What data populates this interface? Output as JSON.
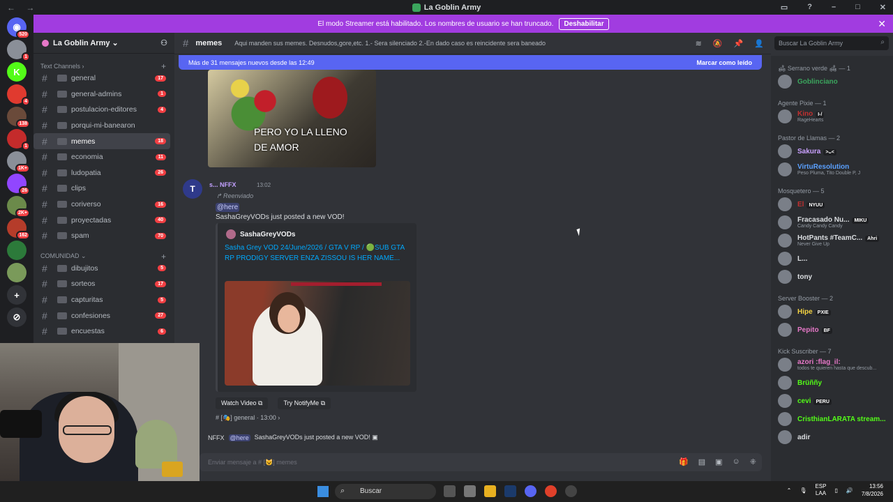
{
  "window": {
    "title": "La Goblin Army",
    "nav": "← →"
  },
  "streamer_banner": {
    "text": "El modo Streamer está habilitado. Los nombres de usuario se han truncado.",
    "button": "Deshabilitar",
    "close": "✕"
  },
  "servers": [
    {
      "color": "#5865f2",
      "badge": "520",
      "glyph": "◉"
    },
    {
      "color": "#8a8f98",
      "badge": "1",
      "glyph": ""
    },
    {
      "color": "#53fc18",
      "badge": "",
      "glyph": "K"
    },
    {
      "color": "#e03a2f",
      "badge": "4",
      "glyph": ""
    },
    {
      "color": "#6a4a3a",
      "badge": "138",
      "glyph": ""
    },
    {
      "color": "#c42b2b",
      "badge": "1",
      "glyph": ""
    },
    {
      "color": "#8a8f98",
      "badge": "1K+",
      "glyph": ""
    },
    {
      "color": "#9146ff",
      "badge": "26",
      "glyph": ""
    },
    {
      "color": "#6b8a4a",
      "badge": "2K+",
      "glyph": ""
    },
    {
      "color": "#b53c2a",
      "badge": "162",
      "glyph": ""
    },
    {
      "color": "#2c7a3a",
      "badge": "",
      "glyph": ""
    },
    {
      "color": "#7a9a5a",
      "badge": "",
      "glyph": ""
    },
    {
      "color": "#313338",
      "badge": "",
      "glyph": "+"
    },
    {
      "color": "#313338",
      "badge": "",
      "glyph": "⊘"
    }
  ],
  "guild": {
    "name": "La Goblin Army ⌄"
  },
  "categories": {
    "text": "Text Channels ›",
    "comunidad": "COMUNIDAD ⌄"
  },
  "channels": [
    {
      "name": "general",
      "count": "17"
    },
    {
      "name": "general-admins",
      "count": "1"
    },
    {
      "name": "postulacion-editores",
      "count": "4"
    },
    {
      "name": "porqui-mi-banearon",
      "count": ""
    },
    {
      "name": "memes",
      "count": "18"
    },
    {
      "name": "economia",
      "count": "11"
    },
    {
      "name": "ludopatia",
      "count": "26"
    },
    {
      "name": "clips",
      "count": ""
    },
    {
      "name": "coriverso",
      "count": "16"
    },
    {
      "name": "proyectadas",
      "count": "40"
    },
    {
      "name": "spam",
      "count": "70"
    }
  ],
  "channels2": [
    {
      "name": "dibujitos",
      "count": "5"
    },
    {
      "name": "sorteos",
      "count": "17"
    },
    {
      "name": "capturitas",
      "count": "5"
    },
    {
      "name": "confesiones",
      "count": "27"
    },
    {
      "name": "encuestas",
      "count": "6"
    }
  ],
  "channel_header": {
    "name": "memes",
    "topic": "Aqui manden sus memes. Desnudos,gore,etc. 1.- Sera silenciado 2.-En dado caso es reincidente sera baneado"
  },
  "search": {
    "placeholder": "Buscar La Goblin Army"
  },
  "new_messages": {
    "text": "Más de 31 mensajes nuevos desde las 12:49",
    "mark": "Marcar como leído"
  },
  "meme": {
    "caption": "PERO YO LA LLENO\nDE AMOR"
  },
  "message": {
    "username": "s... NFFX",
    "time": "13:02",
    "forwarded": "↱ Reenviado",
    "mention": "@here",
    "text": "SashaGreyVODs just posted a new VOD!",
    "embed_author": "SashaGreyVODs",
    "embed_title": "Sasha Grey VOD 24/June/2026 / GTA V RP / 🟢SUB GTA RP PRODIGY SERVER ENZA ZISSOU IS HER NAME...",
    "btn_watch": "Watch Video ⧉",
    "btn_notify": "Try NotifyMe ⧉",
    "channel_ref": "# [🎭] general · 13:00 ›"
  },
  "next_message": {
    "user": "NFFX",
    "mention": "@here",
    "text": "SashaGreyVODs just posted a new VOD! ▣"
  },
  "composer": {
    "placeholder": "Enviar mensaje a # [😺] memes"
  },
  "member_groups": [
    {
      "title": "🛋 Serrano verde 🛋 — 1",
      "members": [
        {
          "name": "Goblinciano",
          "color": "#3ba55d",
          "sub": "",
          "tag": ""
        }
      ]
    },
    {
      "title": "Agente Pixie — 1",
      "members": [
        {
          "name": "Kino",
          "color": "#c03030",
          "sub": "RageHearts",
          "tag": "I-/"
        }
      ]
    },
    {
      "title": "Pastor de Llamas — 2",
      "members": [
        {
          "name": "Sakura",
          "color": "#c9a0ff",
          "sub": "",
          "tag": ">ᴗ<"
        },
        {
          "name": "VirtuResolution",
          "color": "#5aa0ff",
          "sub": "Peso Pluma, Tito Double P, J",
          "tag": ""
        }
      ]
    },
    {
      "title": "Mosquetero — 5",
      "members": [
        {
          "name": "El",
          "color": "#c03030",
          "sub": "",
          "tag": "NYUU"
        },
        {
          "name": "Fracasado Nu...",
          "color": "#dbdee1",
          "sub": "Candy Candy Candy",
          "tag": "MIKU"
        },
        {
          "name": "HotPants #TeamC...",
          "color": "#dbdee1",
          "sub": "Never Give Up",
          "tag": "Ahri"
        },
        {
          "name": "L...",
          "color": "#dbdee1",
          "sub": "",
          "tag": ""
        },
        {
          "name": "tony",
          "color": "#dbdee1",
          "sub": "",
          "tag": ""
        }
      ]
    },
    {
      "title": "Server Booster — 2",
      "members": [
        {
          "name": "Hipe",
          "color": "#f5d442",
          "sub": "",
          "tag": "PXIE"
        },
        {
          "name": "Pepito",
          "color": "#e678c8",
          "sub": "",
          "tag": "BF"
        }
      ]
    },
    {
      "title": "Kick Suscriber — 7",
      "members": [
        {
          "name": "azori :flag_il:",
          "color": "#e678c8",
          "sub": "todos te quieren hasta que descub...",
          "tag": ""
        },
        {
          "name": "Brüññy",
          "color": "#53fc18",
          "sub": "",
          "tag": ""
        },
        {
          "name": "cevi",
          "color": "#53fc18",
          "sub": "",
          "tag": "PERU"
        },
        {
          "name": "CristhianLARATA stream...",
          "color": "#53fc18",
          "sub": "",
          "tag": ""
        },
        {
          "name": "adir",
          "color": "#dbdee1",
          "sub": "",
          "tag": ""
        }
      ]
    }
  ],
  "taskbar": {
    "search": "Buscar",
    "lang": "ESP\nLAA",
    "time": "13:56",
    "date": "7/8/2026"
  }
}
